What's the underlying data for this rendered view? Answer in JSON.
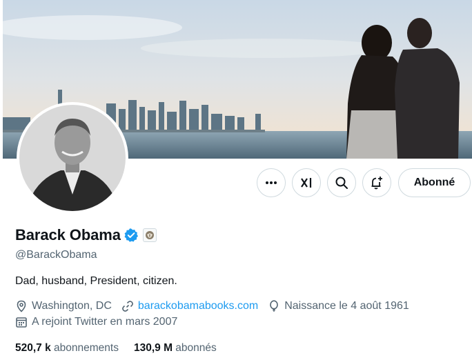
{
  "profile": {
    "name": "Barack Obama",
    "handle": "@BarackObama",
    "bio": "Dad, husband, President, citizen.",
    "location": "Washington, DC",
    "website": "barackobamabooks.com",
    "birth": "Naissance le 4 août 1961",
    "joined": "A rejoint Twitter en mars 2007",
    "verified": true
  },
  "stats": {
    "following_count": "520,7 k",
    "following_label": "abonnements",
    "followers_count": "130,9 M",
    "followers_label": "abonnés"
  },
  "actions": {
    "follow_label": "Abonné",
    "icons": [
      "more-icon",
      "grok-icon",
      "search-icon",
      "notification-bell-icon"
    ]
  },
  "colors": {
    "accent": "#1d9bf0",
    "text": "#0f1419",
    "muted": "#536471",
    "border": "#cfd9de"
  }
}
